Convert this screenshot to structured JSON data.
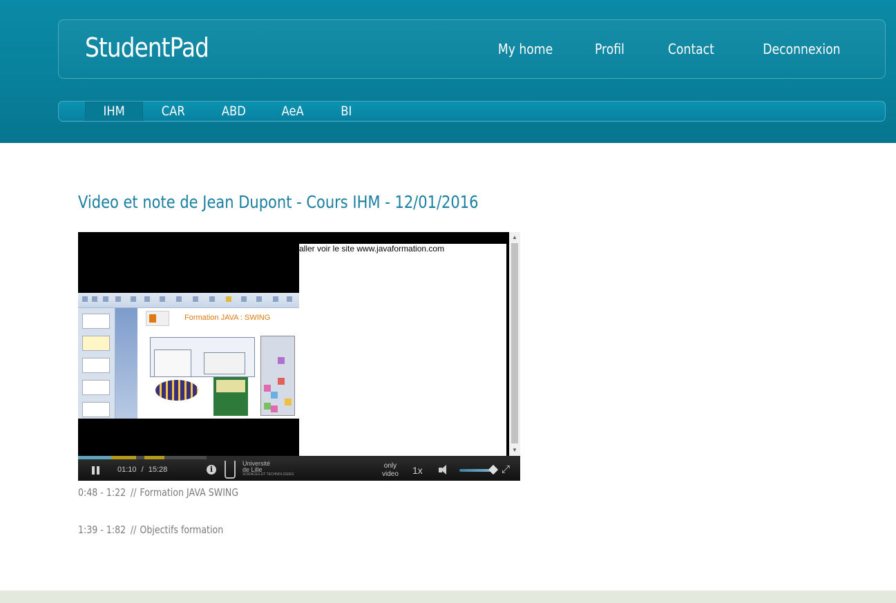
{
  "header": {
    "brand": "StudentPad",
    "nav": [
      "My home",
      "Profil",
      "Contact",
      "Deconnexion"
    ]
  },
  "subnav": {
    "items": [
      "IHM",
      "CAR",
      "ABD",
      "AeA",
      "BI"
    ],
    "active": "IHM"
  },
  "main": {
    "title": "Video et note de Jean Dupont - Cours IHM - 12/01/2016"
  },
  "player": {
    "overlay_text": "aller voir le site www.javaformation.com",
    "slide_title": "Formation JAVA : SWING",
    "current_time": "01:10",
    "time_separator": "/",
    "duration": "15:28",
    "progress_fraction": 0.075,
    "buffered_fraction": 0.29,
    "info_glyph": "i",
    "university_line1": "Université",
    "university_line2": "de Lille",
    "university_sub": "SCIENCES ET TECHNOLOGIES",
    "only_label": "only",
    "video_label": "video",
    "speed": "1x",
    "fullscreen_glyph": "⤢",
    "icons": [
      "pause-icon",
      "info-icon",
      "volume-icon",
      "fullscreen-icon"
    ]
  },
  "notes": [
    {
      "range": "0:48 - 1:22",
      "separator": "//",
      "text": "Formation JAVA SWING"
    },
    {
      "range": "1:39 - 1:82",
      "separator": "//",
      "text": "Objectifs formation"
    }
  ],
  "colors": {
    "header": "#08819c",
    "title": "#1a7fa0",
    "note": "#7b7b7b",
    "footer": "#e4e9dd"
  }
}
